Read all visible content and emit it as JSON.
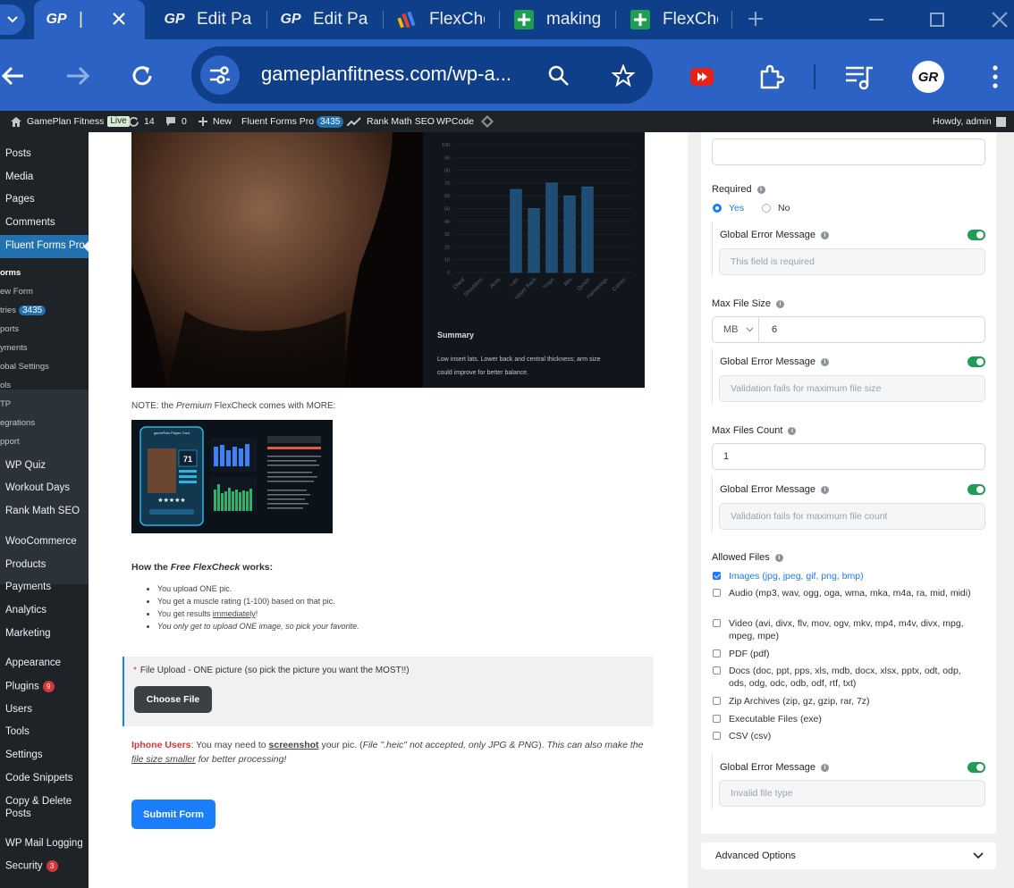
{
  "browser": {
    "tabs": [
      {
        "title": "|"
      },
      {
        "title": "Edit Pag"
      },
      {
        "title": "Edit Pag"
      },
      {
        "title": "FlexChe"
      },
      {
        "title": "making"
      },
      {
        "title": "FlexChe"
      }
    ],
    "url": "gameplanfitness.com/wp-a...",
    "icons": [
      "back-arrow",
      "forward-arrow",
      "reload",
      "site-settings",
      "zoom",
      "bookmark-star",
      "youtube-ext",
      "extensions-puzzle",
      "media-queue",
      "profile-avatar",
      "kebab-menu"
    ]
  },
  "adminbar": {
    "site_name": "GamePlan Fitness",
    "live": "Live",
    "updates": "14",
    "comments": "0",
    "new": "New",
    "fluent": "Fluent Forms Pro",
    "fluent_count": "3435",
    "rankmath": "Rank Math SEO",
    "wpcode": "WPCode",
    "howdy": "Howdy, admin"
  },
  "sidebar": {
    "top_items": [
      "Posts",
      "Media",
      "Pages",
      "Comments"
    ],
    "active_item": "Fluent Forms Pro",
    "sub_items": [
      "orms",
      "ew Form",
      "tries",
      "ports",
      "yments",
      "obal Settings",
      "ols",
      "TP",
      "egrations",
      "pport"
    ],
    "entries_count": "3435",
    "items_mid": [
      "WP Quiz",
      "Workout Days",
      "Rank Math SEO"
    ],
    "items_shop": [
      "WooCommerce",
      "Products",
      "Payments",
      "Analytics",
      "Marketing"
    ],
    "items_bottom": [
      "Appearance",
      "Plugins",
      "Users",
      "Tools",
      "Settings",
      "Code Snippets",
      "Copy & Delete",
      "Posts",
      "WP Mail Logging",
      "Security"
    ],
    "plugins_count": "9",
    "security_count": "3"
  },
  "main": {
    "chart_data": {
      "type": "bar",
      "categories": [
        "Chest",
        "Shoulders",
        "Arms",
        "Lats",
        "Upper Back",
        "Traps",
        "Abs",
        "Quads",
        "Hamstrings",
        "Calves"
      ],
      "values": [
        null,
        null,
        null,
        65,
        50,
        70,
        60,
        67,
        null,
        null
      ],
      "ylim": [
        0,
        100
      ],
      "yticks": [
        "100",
        "90",
        "80",
        "70",
        "60",
        "50",
        "40",
        "30",
        "20",
        "10",
        "0"
      ],
      "summary_title": "Summary",
      "summary_text": "Low insert lats. Lower back and central thickness; arm size could improve for better balance."
    },
    "note_prefix": "NOTE: the ",
    "note_em": "Premium",
    "note_suffix": " FlexCheck comes with MORE:",
    "promo_card": {
      "title": "gamePlan Player Card",
      "score": "71"
    },
    "how_prefix": "How the ",
    "how_em": "Free FlexCheck",
    "how_suffix": " works:",
    "bullets": [
      "You upload ONE pic.",
      "You get a muscle rating (1-100) based on that pic.",
      "You get results ",
      "You only get to upload ONE image, so pick your favorite."
    ],
    "bullet_underline": "immediately",
    "bullet_end": "!",
    "upload_star": "*",
    "upload_label": "File Upload - ONE picture (so pick the picture you want the MOST!!)",
    "choose_file": "Choose File",
    "iphone_bold": "Iphone Users",
    "iphone_text1": ": You may need to ",
    "iphone_screenshot": "screenshot",
    "iphone_text2": " your pic. (",
    "iphone_em1": "File \".heic\" not accepted, only JPG & PNG",
    "iphone_text3": "). ",
    "iphone_em2": "This can also make the ",
    "iphone_em_u": "file size smaller",
    "iphone_em3": " for better processing!",
    "submit": "Submit Form"
  },
  "panel": {
    "required_label": "Required",
    "yes": "Yes",
    "no": "No",
    "gem_label": "Global Error Message",
    "err_required": "This field is required",
    "max_size_label": "Max File Size",
    "unit": "MB",
    "max_size_value": "6",
    "err_size": "Validation fails for maximum file size",
    "max_count_label": "Max Files Count",
    "max_count_value": "1",
    "err_count": "Validation fails for maximum file count",
    "allowed_label": "Allowed Files",
    "allowed": [
      {
        "label": "Images (jpg, jpeg, gif, png, bmp)",
        "checked": true
      },
      {
        "label": "Audio (mp3, wav, ogg, oga, wma, mka, m4a, ra, mid, midi)",
        "checked": false
      },
      {
        "label": "Video (avi, divx, flv, mov, ogv, mkv, mp4, m4v, divx, mpg, mpeg, mpe)",
        "checked": false
      },
      {
        "label": "PDF (pdf)",
        "checked": false
      },
      {
        "label": "Docs (doc, ppt, pps, xls, mdb, docx, xlsx, pptx, odt, odp, ods, odg, odc, odb, odf, rtf, txt)",
        "checked": false
      },
      {
        "label": "Zip Archives (zip, gz, gzip, rar, 7z)",
        "checked": false
      },
      {
        "label": "Executable Files (exe)",
        "checked": false
      },
      {
        "label": "CSV (csv)",
        "checked": false
      }
    ],
    "err_type": "Invalid file type",
    "advanced": "Advanced Options"
  },
  "colors": {
    "accent": "#1a7efb",
    "wp_dark": "#1d2327",
    "wp_blue": "#2271b1",
    "toggle_green": "#1f9d55",
    "browser_blue": "#2b62c4"
  }
}
